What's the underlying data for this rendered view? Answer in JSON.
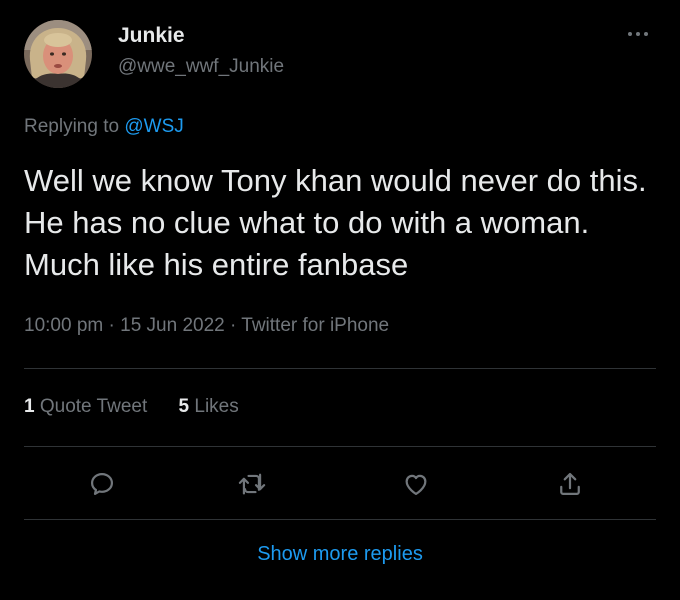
{
  "author": {
    "display_name": "Junkie",
    "handle": "@wwe_wwf_Junkie",
    "avatar_icon": "avatar-photo"
  },
  "reply_context": {
    "prefix": "Replying to ",
    "mention": "@WSJ"
  },
  "tweet": {
    "text": "Well we know Tony khan would never do this. He has no clue what to do with a woman. Much like his entire fanbase",
    "time": "10:00 pm",
    "separator": "·",
    "date": "15 Jun 2022",
    "source": "Twitter for iPhone"
  },
  "stats": {
    "quote_count": "1",
    "quote_label": "Quote Tweet",
    "like_count": "5",
    "like_label": "Likes"
  },
  "actions": {
    "reply_icon": "reply-icon",
    "retweet_icon": "retweet-icon",
    "like_icon": "heart-icon",
    "share_icon": "share-icon"
  },
  "footer": {
    "show_more_label": "Show more replies"
  },
  "colors": {
    "background": "#000000",
    "primary_text": "#e7e9ea",
    "secondary_text": "#71767b",
    "accent": "#1d9bf0",
    "divider": "#2f3336"
  }
}
